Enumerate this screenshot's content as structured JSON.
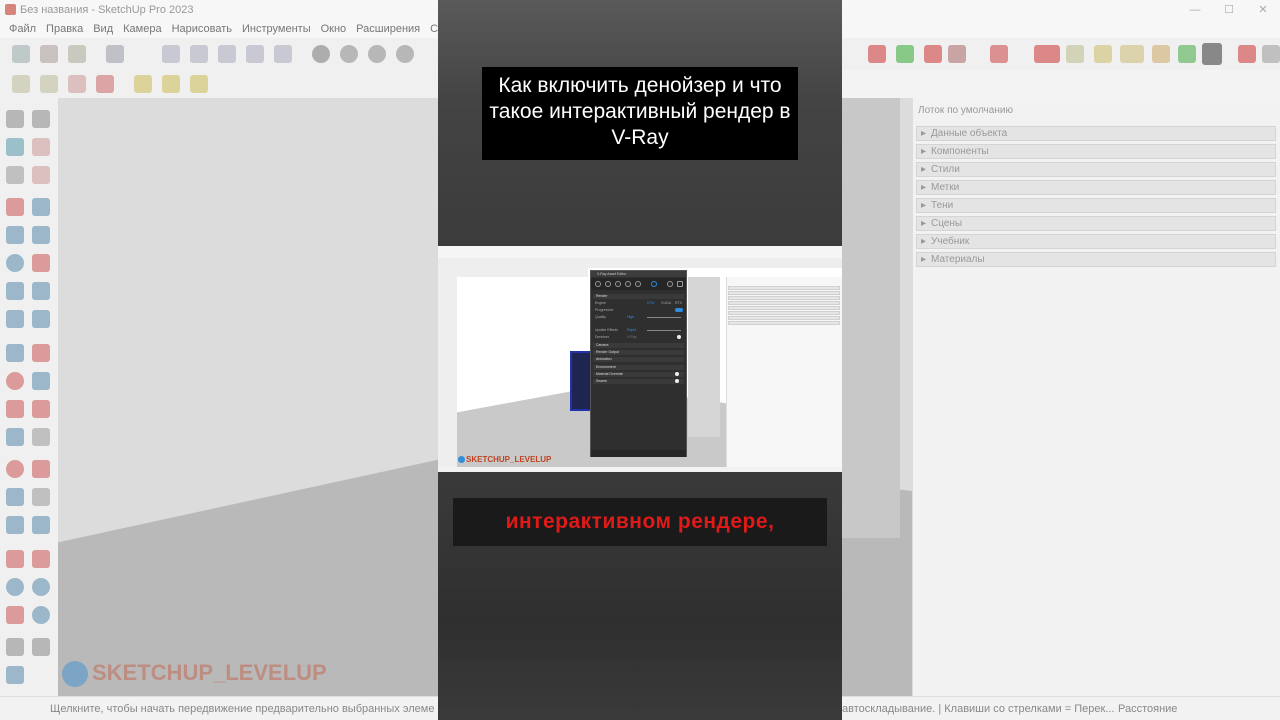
{
  "background_app": {
    "window_title": "Без названия - SketchUp Pro 2023",
    "menu": [
      "Файл",
      "Правка",
      "Вид",
      "Камера",
      "Нарисовать",
      "Инструменты",
      "Окно",
      "Расширения",
      "Справка"
    ],
    "tray": {
      "title": "Лоток по умолчанию",
      "items": [
        "Данные объекта",
        "Компоненты",
        "Стили",
        "Метки",
        "Тени",
        "Сцены",
        "Учебник",
        "Материалы"
      ]
    },
    "status": {
      "hint": "Щелкните, чтобы начать передвижение предварительно выбранных элеме",
      "hint_right": "автоскладывание. | Клавиши со стрелками = Перек...",
      "measure_label": "Расстояние"
    },
    "watermark": "SKETCHUP_LEVELUP"
  },
  "video": {
    "caption_top": "Как включить денойзер и что такое интерактивный рендер в V-Ray",
    "caption_bottom": "интерактивном рендере,",
    "inner_watermark": "SKETCHUP_LEVELUP"
  },
  "vray_panel": {
    "title": "V-Ray Asset Editor",
    "sections": [
      "Render",
      "Camera",
      "Render Output",
      "Animation",
      "Environment",
      "Material Override",
      "Swarm"
    ],
    "rows": {
      "engine_label": "Engine",
      "engine_values": [
        "CPU",
        "CUDA",
        "RTX"
      ],
      "progressive_label": "Progressive",
      "quality_label": "Quality",
      "quality_value": "High",
      "update_effects_label": "Update Effects",
      "update_effects_value": "Rapid",
      "denoiser_label": "Denoiser",
      "denoiser_value": "V-Ray"
    }
  },
  "colors": {
    "caption_bottom_text": "#e01919",
    "vray_accent": "#2e8de0",
    "watermark": "#c0431f"
  }
}
